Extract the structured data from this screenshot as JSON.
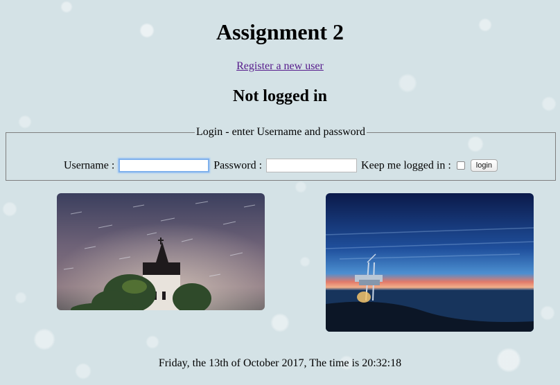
{
  "page": {
    "title": "Assignment 2",
    "register_link": "Register a new user",
    "status": "Not logged in"
  },
  "login": {
    "legend": "Login - enter Username and password",
    "username_label": "Username :",
    "username_value": "",
    "password_label": "Password :",
    "password_value": "",
    "remember_label": "Keep me logged in :",
    "remember_checked": false,
    "submit_label": "login"
  },
  "images": [
    {
      "name": "church-night-sky-photo"
    },
    {
      "name": "pier-sunset-photo"
    }
  ],
  "footer": {
    "datetime": "Friday, the 13th of October 2017, The time is 20:32:18"
  }
}
